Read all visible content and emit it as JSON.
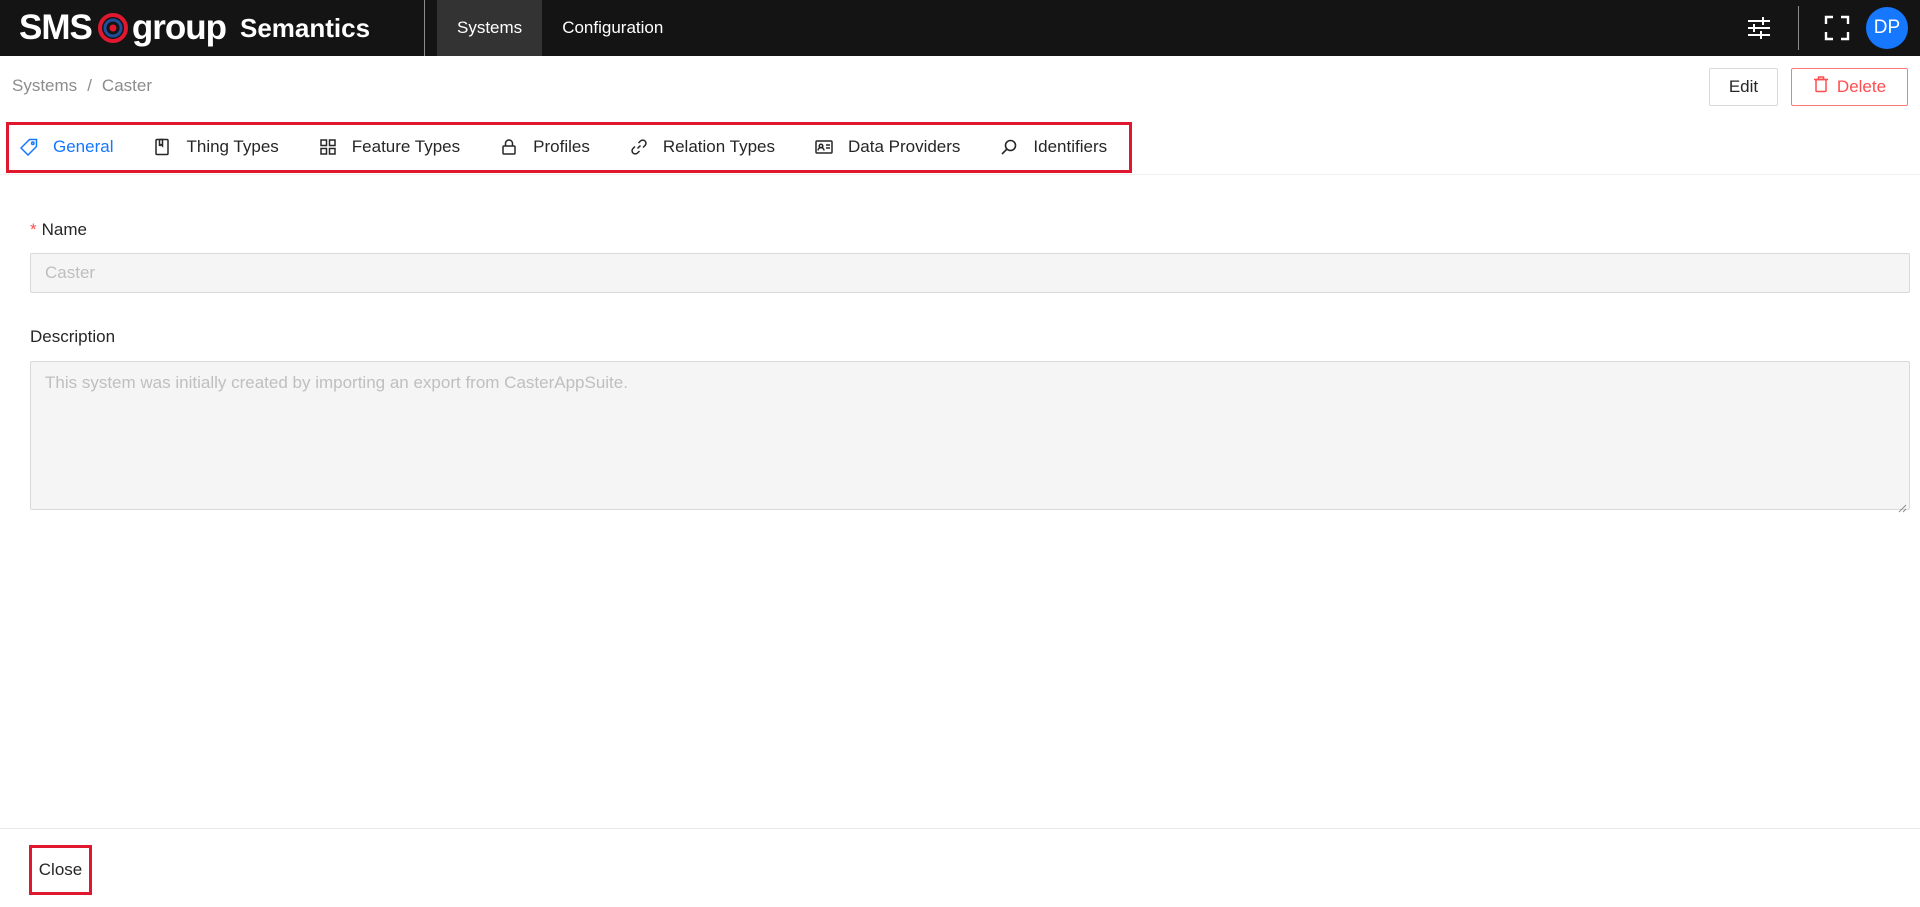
{
  "header": {
    "logo_sms": "SMS",
    "logo_group": "group",
    "logo_product": "Semantics",
    "nav": [
      {
        "label": "Systems",
        "active": true
      },
      {
        "label": "Configuration",
        "active": false
      }
    ],
    "avatar_initials": "DP",
    "icons": [
      "sliders-icon",
      "fullscreen-icon"
    ]
  },
  "breadcrumb": [
    "Systems",
    "Caster"
  ],
  "actions": {
    "edit_label": "Edit",
    "delete_label": "Delete"
  },
  "tabs": [
    {
      "label": "General",
      "icon": "tag-icon",
      "active": true
    },
    {
      "label": "Thing Types",
      "icon": "book-icon",
      "active": false
    },
    {
      "label": "Feature Types",
      "icon": "appstore-icon",
      "active": false
    },
    {
      "label": "Profiles",
      "icon": "lock-icon",
      "active": false
    },
    {
      "label": "Relation Types",
      "icon": "link-icon",
      "active": false
    },
    {
      "label": "Data Providers",
      "icon": "idcard-icon",
      "active": false
    },
    {
      "label": "Identifiers",
      "icon": "search-icon",
      "active": false
    }
  ],
  "form": {
    "name_label": "Name",
    "name_required_mark": "*",
    "name_value": "Caster",
    "description_label": "Description",
    "description_value": "This system was initially created by importing an export from CasterAppSuite."
  },
  "footer": {
    "close_label": "Close"
  },
  "colors": {
    "topbar": "#141414",
    "accent": "#1677ff",
    "danger": "#ff4d4f",
    "highlight": "#e0182f"
  }
}
